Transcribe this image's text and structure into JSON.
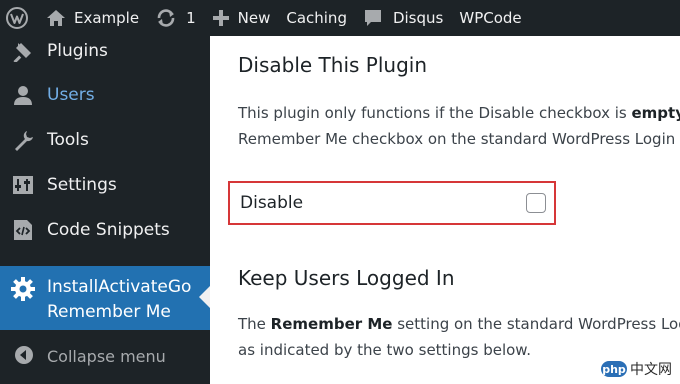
{
  "adminbar": {
    "site_name": "Example",
    "updates_count": "1",
    "new_label": "New",
    "caching_label": "Caching",
    "disqus_label": "Disqus",
    "wpcode_label": "WPCode"
  },
  "sidebar": {
    "items": [
      {
        "label": "Plugins",
        "icon": "plugins-icon"
      },
      {
        "label": "Users",
        "icon": "users-icon"
      },
      {
        "label": "Tools",
        "icon": "tools-icon"
      },
      {
        "label": "Settings",
        "icon": "settings-icon"
      },
      {
        "label": "Code Snippets",
        "icon": "code-snippets-icon"
      }
    ],
    "current": {
      "line1": "InstallActivateGo",
      "line2": "Remember Me",
      "icon": "gear-icon"
    },
    "collapse_label": "Collapse menu"
  },
  "main": {
    "section1_title": "Disable This Plugin",
    "section1_line1_pre": "This plugin only functions if the Disable checkbox is ",
    "section1_line1_bold": "empty",
    "section1_line2": "Remember Me checkbox on the standard WordPress Login",
    "disable_label": "Disable",
    "disable_checked": false,
    "section2_title": "Keep Users Logged In",
    "section2_line1_pre": "The ",
    "section2_line1_bold": "Remember Me",
    "section2_line1_post": " setting on the standard WordPress Log",
    "section2_line2": "as indicated by the two settings below."
  },
  "watermark": {
    "logo_text": "php",
    "text": "中文网"
  },
  "colors": {
    "adminbar_bg": "#1d2327",
    "sidebar_bg": "#1d2327",
    "current_bg": "#2271b1",
    "users_label": "#72aee6",
    "highlight_border": "#d63638"
  }
}
